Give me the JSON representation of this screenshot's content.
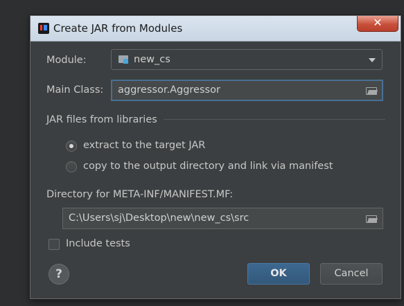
{
  "dialog": {
    "title": "Create JAR from Modules",
    "close_symbol": "✕"
  },
  "module": {
    "label": "Module:",
    "value": "new_cs"
  },
  "main_class": {
    "label": "Main Class:",
    "value": "aggressor.Aggressor"
  },
  "libraries": {
    "group_label": "JAR files from libraries",
    "options": [
      {
        "label": "extract to the target JAR",
        "selected": true
      },
      {
        "label": "copy to the output directory and link via manifest",
        "selected": false
      }
    ]
  },
  "manifest": {
    "label": "Directory for META-INF/MANIFEST.MF:",
    "value": "C:\\Users\\sj\\Desktop\\new\\new_cs\\src"
  },
  "include_tests": {
    "label": "Include tests",
    "checked": false
  },
  "buttons": {
    "help": "?",
    "ok": "OK",
    "cancel": "Cancel"
  },
  "colors": {
    "dialog_bg": "#3c3f41",
    "titlebar": "#d3dfeb",
    "accent_focus": "#4a6f94",
    "ok_button": "#365d82",
    "close_button": "#c8503b"
  },
  "icons": {
    "app": "intellij-icon",
    "module": "module-folder-icon",
    "dropdown": "chevron-down-icon",
    "browse": "open-folder-icon",
    "close": "close-icon",
    "help": "help-icon"
  }
}
